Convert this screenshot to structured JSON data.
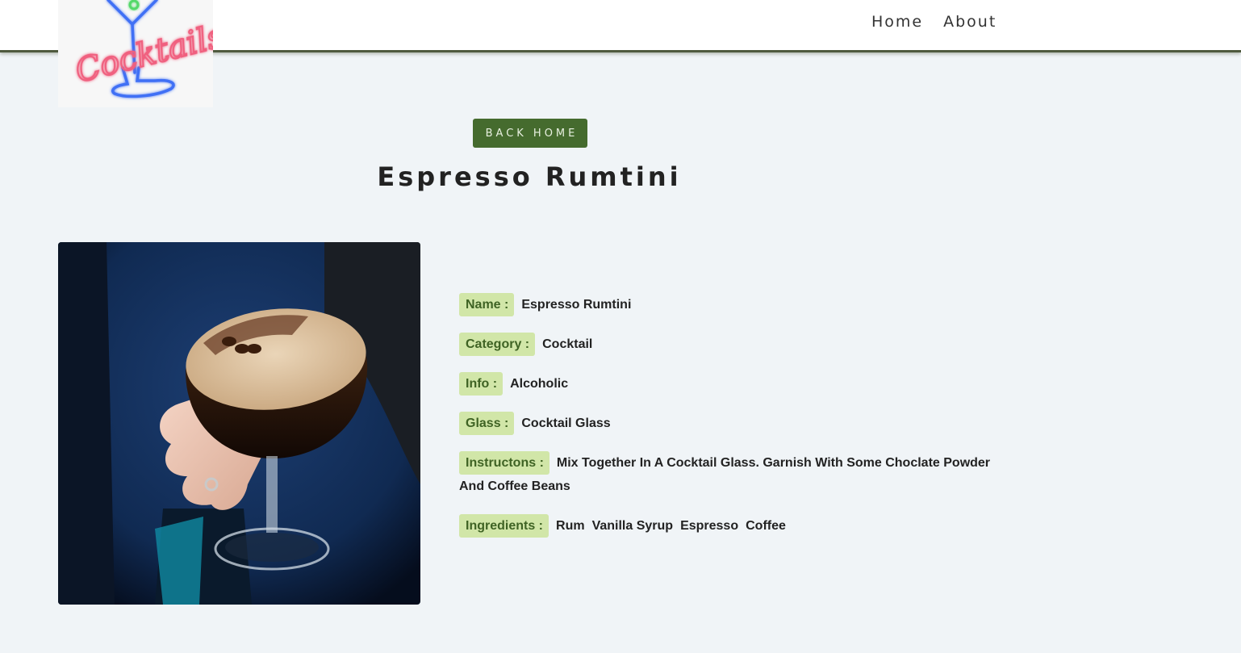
{
  "logo": {
    "text": "Cocktails"
  },
  "nav": {
    "home": "Home",
    "about": "About"
  },
  "back_button": "BACK HOME",
  "drink": {
    "title": "Espresso Rumtini",
    "image_alt": "Espresso Rumtini",
    "fields": {
      "name_label": "Name :",
      "name_value": "Espresso Rumtini",
      "category_label": "Category :",
      "category_value": "Cocktail",
      "info_label": "Info :",
      "info_value": "Alcoholic",
      "glass_label": "Glass :",
      "glass_value": "Cocktail Glass",
      "instructions_label": "Instructons :",
      "instructions_value": "Mix Together In A Cocktail Glass. Garnish With Some Choclate Powder And Coffee Beans",
      "ingredients_label": "Ingredients :",
      "ingredients": [
        "Rum",
        "Vanilla Syrup",
        "Espresso",
        "Coffee"
      ]
    }
  },
  "colors": {
    "background": "#f0f4f7",
    "button_bg": "#456b2e",
    "label_bg": "#d1e6a8",
    "label_text": "#3f6324",
    "nav_border": "#4f5a3e"
  }
}
